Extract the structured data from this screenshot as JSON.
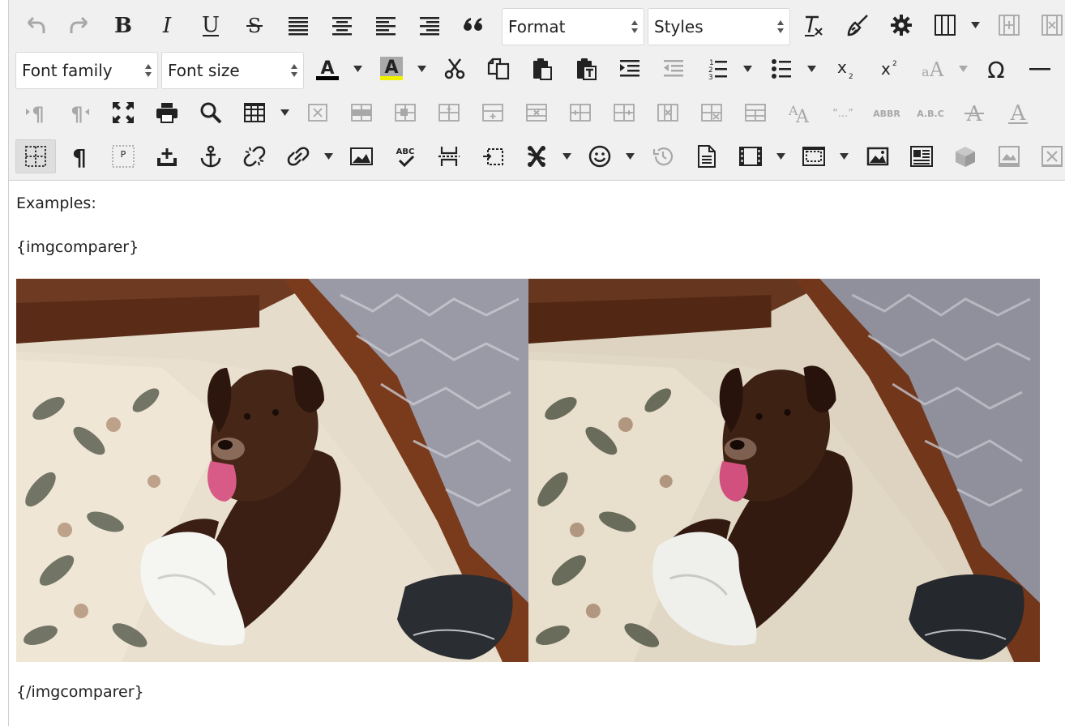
{
  "toolbar": {
    "format_select": {
      "label": "Format"
    },
    "styles_select": {
      "label": "Styles"
    },
    "font_family_select": {
      "label": "Font family"
    },
    "font_size_select": {
      "label": "Font size"
    },
    "text_color": {
      "glyph": "A",
      "swatch": "#000000"
    },
    "background_color": {
      "glyph": "A",
      "swatch": "#f2f200"
    },
    "glyphs": {
      "bold": "B",
      "italic": "I",
      "underline": "U",
      "strike": "S",
      "omega": "Ω",
      "subscript_x": "x",
      "subscript_n": "2",
      "superscript_x": "x",
      "superscript_n": "2",
      "quote_text": "“...”",
      "abbr": "ABBR",
      "acronym": "A.B.C",
      "pilcrow": "¶",
      "p_block": "P",
      "abc": "ABC",
      "aa_small": "a",
      "aa_big": "A"
    }
  },
  "content": {
    "paragraphs": [
      "Examples:",
      "{imgcomparer}",
      "{/imgcomparer}"
    ],
    "images": [
      {
        "name": "dog-photo-original",
        "alt": "dog"
      },
      {
        "name": "dog-photo-compared",
        "alt": "dog"
      }
    ]
  },
  "colors": {
    "toolbar_bg": "#f0f0f0",
    "icon": "#222222",
    "icon_disabled": "#a8a8a8",
    "active_bg": "#dedede"
  }
}
